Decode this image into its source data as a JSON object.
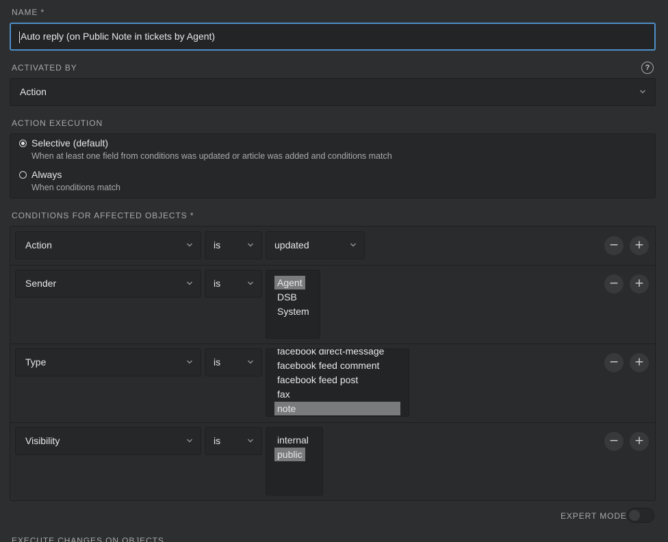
{
  "name": {
    "label": "NAME *",
    "value": "Auto reply (on Public Note in tickets by Agent)"
  },
  "activated_by": {
    "label": "ACTIVATED BY",
    "help_icon": "?",
    "value": "Action"
  },
  "action_execution": {
    "label": "ACTION EXECUTION",
    "options": [
      {
        "title": "Selective (default)",
        "description": "When at least one field from conditions was updated or article was added and conditions match",
        "checked": true
      },
      {
        "title": "Always",
        "description": "When conditions match",
        "checked": false
      }
    ]
  },
  "conditions": {
    "label": "CONDITIONS FOR AFFECTED OBJECTS *",
    "rows": [
      {
        "attribute": "Action",
        "operator": "is",
        "value": "updated"
      },
      {
        "attribute": "Sender",
        "operator": "is",
        "options": [
          "Agent",
          "DSB",
          "System"
        ],
        "selected": [
          "Agent"
        ]
      },
      {
        "attribute": "Type",
        "operator": "is",
        "options": [
          "facebook direct-message",
          "facebook feed comment",
          "facebook feed post",
          "fax",
          "note"
        ],
        "selected": [
          "note"
        ]
      },
      {
        "attribute": "Visibility",
        "operator": "is",
        "options": [
          "internal",
          "public"
        ],
        "selected": [
          "public"
        ]
      }
    ],
    "remove_symbol": "−",
    "add_symbol": "+"
  },
  "expert_mode": {
    "label": "EXPERT MODE",
    "enabled": false
  },
  "execute_changes": {
    "label": "EXECUTE CHANGES ON OBJECTS"
  },
  "colors": {
    "background": "#2d2e30",
    "field": "#262729",
    "focus": "#4e8fc8",
    "selected_option": "#7a7b7d"
  },
  "icons": [
    "chevron-down-icon",
    "help-icon",
    "minus-icon",
    "plus-icon"
  ]
}
